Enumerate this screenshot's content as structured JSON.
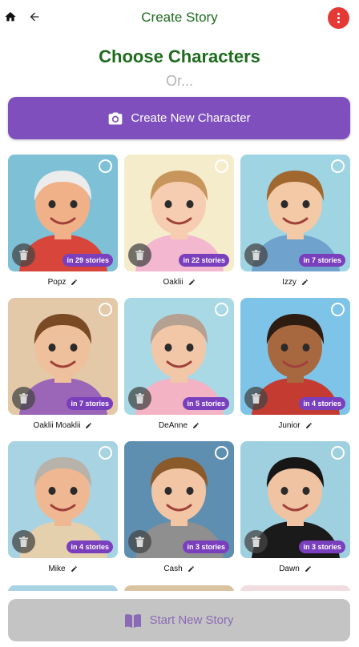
{
  "header": {
    "title": "Create Story"
  },
  "page": {
    "heading": "Choose Characters",
    "or_label": "Or..."
  },
  "create_button": {
    "label": "Create New Character"
  },
  "start_button": {
    "label": "Start New Story"
  },
  "characters": [
    {
      "name": "Popz",
      "stories": "in 29 stories",
      "colors": {
        "bg": "#7ec0d6",
        "skin": "#f1b188",
        "accent": "#d8453b",
        "hair": "#ececec"
      }
    },
    {
      "name": "Oaklii",
      "stories": "in 22 stories",
      "colors": {
        "bg": "#f5eccc",
        "skin": "#f6cdb0",
        "accent": "#f3b7cf",
        "hair": "#c8955c"
      }
    },
    {
      "name": "Izzy",
      "stories": "in 7 stories",
      "colors": {
        "bg": "#9fd4e3",
        "skin": "#f3c9a6",
        "accent": "#6fa3cd",
        "hair": "#a0672f"
      }
    },
    {
      "name": "Oaklii Moaklii",
      "stories": "in 7 stories",
      "colors": {
        "bg": "#e3c9a8",
        "skin": "#efc09c",
        "accent": "#9b66b7",
        "hair": "#7a4a25"
      }
    },
    {
      "name": "DeAnne",
      "stories": "in 5 stories",
      "colors": {
        "bg": "#a9d9e5",
        "skin": "#f2c7a7",
        "accent": "#f4b3c4",
        "hair": "#b5a192"
      }
    },
    {
      "name": "Junior",
      "stories": "in 4 stories",
      "colors": {
        "bg": "#7dc4e8",
        "skin": "#a8683f",
        "accent": "#c43b32",
        "hair": "#2c1c12"
      }
    },
    {
      "name": "Mike",
      "stories": "in 4 stories",
      "colors": {
        "bg": "#a7d3e2",
        "skin": "#efb892",
        "accent": "#e5d0ad",
        "hair": "#b7b2aa"
      }
    },
    {
      "name": "Cash",
      "stories": "in 3 stories",
      "colors": {
        "bg": "#5e8fb0",
        "skin": "#f2c6a5",
        "accent": "#8f8f8f",
        "hair": "#8b5a2b"
      }
    },
    {
      "name": "Dawn",
      "stories": "in 3 stories",
      "colors": {
        "bg": "#9fd0df",
        "skin": "#f0c3a2",
        "accent": "#1a1a1a",
        "hair": "#161616"
      }
    }
  ],
  "partial_row_colors": [
    "#a7d3e2",
    "#d8c4a0",
    "#f1dce0"
  ]
}
